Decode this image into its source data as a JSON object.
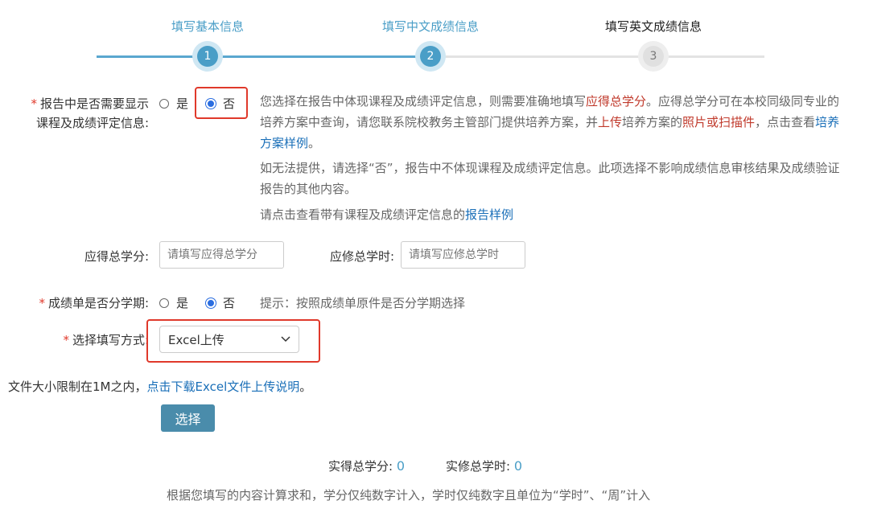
{
  "steps": [
    {
      "title": "填写基本信息",
      "number": "1",
      "state": "done"
    },
    {
      "title": "填写中文成绩信息",
      "number": "2",
      "state": "active"
    },
    {
      "title": "填写英文成绩信息",
      "number": "3",
      "state": "todo"
    }
  ],
  "display_course": {
    "label_line1": "报告中是否需要显示",
    "label_line2": "课程及成绩评定信息:",
    "option_yes": "是",
    "option_no": "否",
    "selected": "否",
    "info": {
      "p1_a": "您选择在报告中体现课程及成绩评定信息，则需要准确地填写",
      "p1_red1": "应得总学分",
      "p1_b": "。应得总学分可在本校同级同专业的培养方案中查询，请您联系院校教务主管部门提供培养方案，并",
      "p1_red2": "上传",
      "p1_c": "培养方案的",
      "p1_red3": "照片或扫描件",
      "p1_d": "，点击查看",
      "p1_link": "培养方案样例",
      "p1_e": "。",
      "p2": "如无法提供，请选择“否”，报告中不体现课程及成绩评定信息。此项选择不影响成绩信息审核结果及成绩验证报告的其他内容。",
      "p3_a": "请点击查看带有课程及成绩评定信息的",
      "p3_link": "报告样例"
    }
  },
  "credits": {
    "label": "应得总学分:",
    "placeholder": "请填写应得总学分",
    "hours_label": "应修总学时:",
    "hours_placeholder": "请填写应修总学时"
  },
  "semester": {
    "label": "成绩单是否分学期:",
    "option_yes": "是",
    "option_no": "否",
    "selected": "否",
    "hint": "提示：按照成绩单原件是否分学期选择"
  },
  "fill_method": {
    "label": "选择填写方式:",
    "value": "Excel上传"
  },
  "upload": {
    "note": "文件大小限制在1M之内，",
    "link": "点击下载Excel文件上传说明",
    "note_end": "。",
    "button": "选择"
  },
  "totals": {
    "credits_label": "实得总学分:",
    "credits_value": "0",
    "hours_label": "实修总学时:",
    "hours_value": "0",
    "footnote": "根据您填写的内容计算求和，学分仅纯数字计入，学时仅纯数字且单位为“学时”、“周”计入"
  },
  "colors": {
    "accent": "#4a9ec7",
    "highlight_box": "#e0392b",
    "radio_selected": "#2a6de0"
  }
}
